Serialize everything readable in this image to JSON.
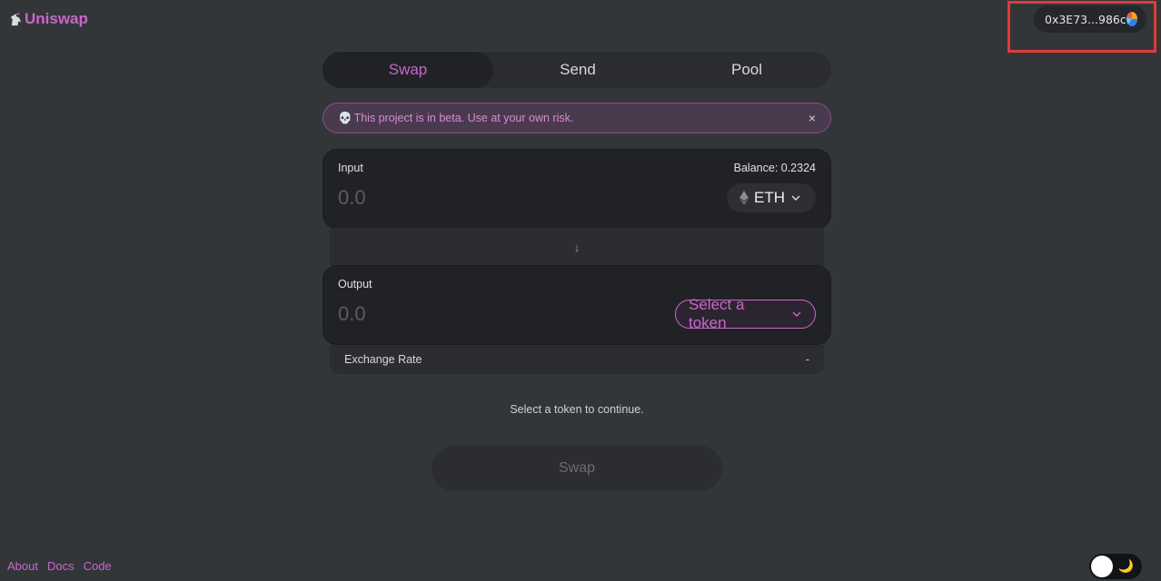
{
  "brand": {
    "name": "Uniswap",
    "icon": "unicorn-icon",
    "color": "#c966c9"
  },
  "wallet": {
    "address": "0x3E73...986c",
    "identicon": "jazzicon-avatar"
  },
  "tabs": [
    {
      "label": "Swap",
      "active": true
    },
    {
      "label": "Send",
      "active": false
    },
    {
      "label": "Pool",
      "active": false
    }
  ],
  "beta_banner": {
    "icon": "skull-icon",
    "text": "This project is in beta. Use at your own risk.",
    "close": "×"
  },
  "input_panel": {
    "label": "Input",
    "balance": "Balance: 0.2324",
    "placeholder": "0.0",
    "token": "ETH",
    "token_icon": "eth-icon"
  },
  "output_panel": {
    "label": "Output",
    "placeholder": "0.0",
    "token": "Select a token"
  },
  "exchange": {
    "label": "Exchange Rate",
    "value": "-"
  },
  "hint": "Select a token to continue.",
  "swap_button": "Swap",
  "footer": {
    "about": "About",
    "docs": "Docs",
    "code": "Code"
  },
  "theme": {
    "mode_icon": "moon-icon",
    "dark": true
  }
}
